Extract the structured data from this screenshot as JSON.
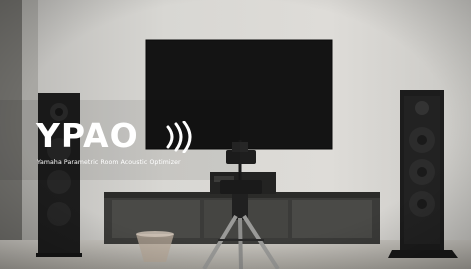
{
  "logo": {
    "wordmark": "YPAO",
    "subtitle": "Yamaha Parametric Room Acoustic Optimizer"
  },
  "colors": {
    "wall": "#d9d8d4",
    "floor": "#bfbcb5",
    "screen": "#151515",
    "speaker": "#1e1e1e",
    "cabinet": "#3a3a38",
    "logo_text": "#ffffff"
  },
  "icons": [
    "sound-wave-icon"
  ]
}
